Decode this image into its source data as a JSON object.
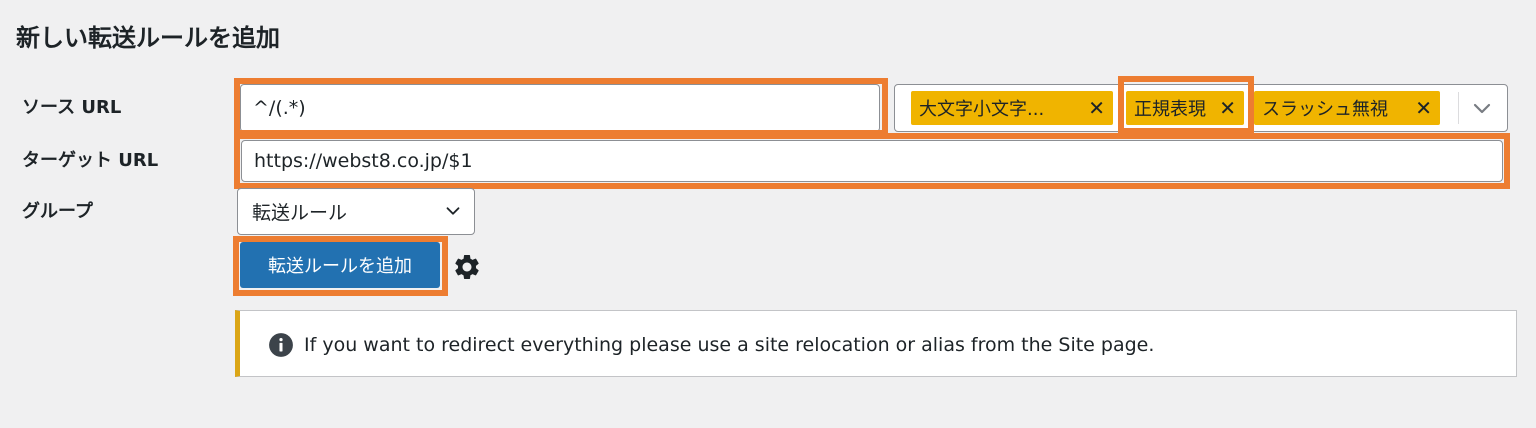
{
  "page": {
    "title": "新しい転送ルールを追加"
  },
  "form": {
    "source_label": "ソース URL",
    "source_value": "^/(.*)",
    "target_label": "ターゲット URL",
    "target_value": "https://webst8.co.jp/$1",
    "group_label": "グループ",
    "group_value": "転送ルール",
    "submit_label": "転送ルールを追加"
  },
  "flags": {
    "tags": [
      {
        "label": "大文字小文字..."
      },
      {
        "label": "正規表現"
      },
      {
        "label": "スラッシュ無視"
      }
    ],
    "remove_glyph": "✕"
  },
  "notice": {
    "text": "If you want to redirect everything please use a site relocation or alias from the Site page."
  },
  "colors": {
    "highlight": "#ed7d31",
    "tag_bg": "#f0b400",
    "primary_button": "#2271b1",
    "notice_border": "#dba617"
  },
  "icons": {
    "dropdown": "chevron-down-icon",
    "settings": "gear-icon",
    "info": "info-icon",
    "remove": "close-icon"
  }
}
